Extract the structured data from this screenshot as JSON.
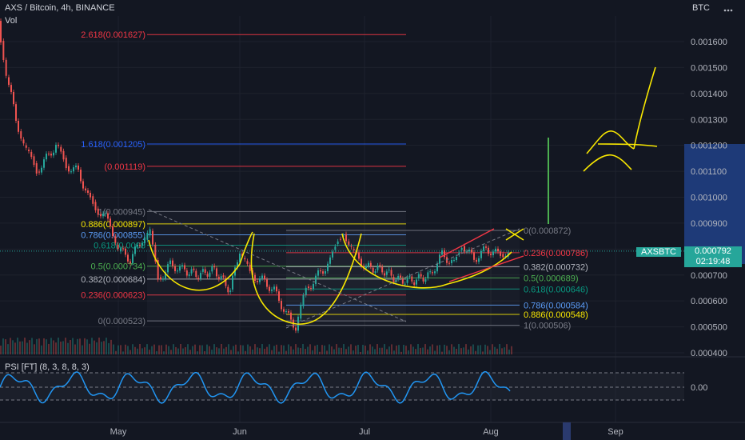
{
  "header": {
    "symbol_line": "AXS / Bitcoin, 4h, BINANCE",
    "volume_label": "Vol",
    "currency": "BTC",
    "menu_icon": "dots-menu-icon"
  },
  "price_axis": {
    "ticks": [
      "0.001600",
      "0.001500",
      "0.001400",
      "0.001300",
      "0.001200",
      "0.001100",
      "0.001000",
      "0.000900",
      "0.000800",
      "0.000700",
      "0.000600",
      "0.000500",
      "0.000400"
    ],
    "current_price": "0.000792",
    "countdown": "02:19:48",
    "symbol_tag": "AXSBTC",
    "highlight_color": "#1e3a78"
  },
  "time_axis": {
    "labels": [
      "May",
      "Jun",
      "Jul",
      "Aug",
      "Sep"
    ]
  },
  "fib_left": {
    "levels": [
      {
        "label": "2.618(0.001627)",
        "color": "#f23645"
      },
      {
        "label": "1.618(0.001205)",
        "color": "#2962ff"
      },
      {
        "label": "(0.001119)",
        "color": "#f23645"
      },
      {
        "label": "1(0.000945)",
        "color": "#787b86"
      },
      {
        "label": "0.886(0.000897)",
        "color": "#f7e600"
      },
      {
        "label": "0.786(0.000855)",
        "color": "#5b9cf6"
      },
      {
        "label": "0.618(0.0008",
        "color": "#089981"
      },
      {
        "label": "0.5(0.000734)",
        "color": "#4caf50"
      },
      {
        "label": "0.382(0.000684)",
        "color": "#b2b5be"
      },
      {
        "label": "0.236(0.000623)",
        "color": "#f23645"
      },
      {
        "label": "0(0.000523)",
        "color": "#787b86"
      }
    ]
  },
  "fib_right": {
    "levels": [
      {
        "label": "0(0.000872)",
        "color": "#787b86"
      },
      {
        "label": "0.236(0.000786)",
        "color": "#f23645"
      },
      {
        "label": "0.382(0.000732)",
        "color": "#b2b5be"
      },
      {
        "label": "0.5(0.000689)",
        "color": "#4caf50"
      },
      {
        "label": "0.618(0.000646)",
        "color": "#089981"
      },
      {
        "label": "0.786(0.000584)",
        "color": "#5b9cf6"
      },
      {
        "label": "0.886(0.000548)",
        "color": "#f7e600"
      },
      {
        "label": "1(0.000506)",
        "color": "#787b86"
      }
    ]
  },
  "indicator": {
    "label": "PSI [FT] (8, 3, 8, 8, 3)",
    "value_tick": "0.00",
    "line_color": "#2196f3"
  },
  "colors": {
    "up": "#26a69a",
    "down": "#ef5350",
    "drawing": "#f7e600",
    "target_bar": "#4caf50"
  },
  "chart_data": {
    "type": "candlestick",
    "title": "AXS / Bitcoin, 4h, BINANCE",
    "ylabel": "BTC",
    "ylim": [
      0.0004,
      0.0017
    ],
    "x_labels": [
      "May",
      "Jun",
      "Jul",
      "Aug",
      "Sep"
    ],
    "close_path": [
      [
        "Apr",
        0.00165
      ],
      [
        "late Apr",
        0.00125
      ],
      [
        "late Apr",
        0.00109
      ],
      [
        "end Apr",
        0.00095
      ],
      [
        "early May",
        0.00085
      ],
      [
        "mid May",
        0.00072
      ],
      [
        "late May",
        0.00068
      ],
      [
        "early Jun",
        0.0007
      ],
      [
        "mid Jun",
        0.00055
      ],
      [
        "late Jun",
        0.00088
      ],
      [
        "early Jul",
        0.0007
      ],
      [
        "mid Jul",
        0.00068
      ],
      [
        "late Jul",
        0.00078
      ],
      [
        "early Aug",
        0.000792
      ]
    ],
    "current_price": 0.000792
  }
}
